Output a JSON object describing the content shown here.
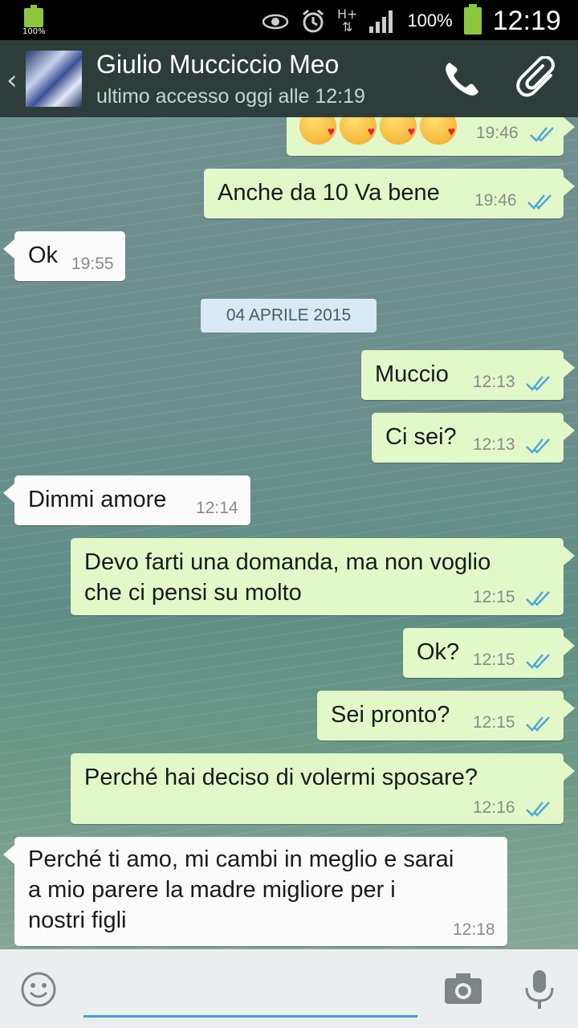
{
  "status_bar": {
    "left_battery_label": "100%",
    "battery_percent": "100%",
    "time": "12:19",
    "network_label": "H+",
    "icons": [
      "eye-icon",
      "alarm-icon",
      "signal-icon",
      "battery-icon"
    ]
  },
  "header": {
    "contact_name": "Giulio Mucciccio Meo",
    "last_seen": "ultimo accesso oggi alle 12:19",
    "icons": [
      "back-icon",
      "call-icon",
      "attach-icon"
    ],
    "bg_color": "#2f3d3a"
  },
  "messages": [
    {
      "dir": "out",
      "text": "😘😘😘😘",
      "time": "19:46"
    },
    {
      "dir": "out",
      "text": "Anche da 10 Va bene",
      "time": "19:46"
    },
    {
      "dir": "in",
      "text": "Ok",
      "time": "19:55"
    },
    {
      "dir": "date",
      "text": "04 APRILE 2015"
    },
    {
      "dir": "out",
      "text": "Muccio",
      "time": "12:13"
    },
    {
      "dir": "out",
      "text": "Ci sei?",
      "time": "12:13"
    },
    {
      "dir": "in",
      "text": "Dimmi amore",
      "time": "12:14"
    },
    {
      "dir": "out",
      "text_lines": [
        "Devo farti una domanda, ma non voglio",
        "che ci pensi su molto"
      ],
      "time": "12:15"
    },
    {
      "dir": "out",
      "text": "Ok?",
      "time": "12:15"
    },
    {
      "dir": "out",
      "text": "Sei pronto?",
      "time": "12:15"
    },
    {
      "dir": "out",
      "text": "Perché hai deciso di volermi sposare?",
      "time": "12:16"
    },
    {
      "dir": "in",
      "text_lines": [
        "Perché ti amo, mi cambi in meglio e sarai",
        "a mio parere la madre migliore per i",
        "nostri figli"
      ],
      "time": "12:18"
    }
  ],
  "input_bar": {
    "placeholder": "",
    "icons": [
      "emoji-icon",
      "camera-icon",
      "mic-icon"
    ]
  },
  "colors": {
    "outgoing_bubble": "#e2f8c9",
    "incoming_bubble": "#fbfbfb",
    "read_ticks": "#4fa8d6",
    "input_underline": "#3aa3d3"
  }
}
